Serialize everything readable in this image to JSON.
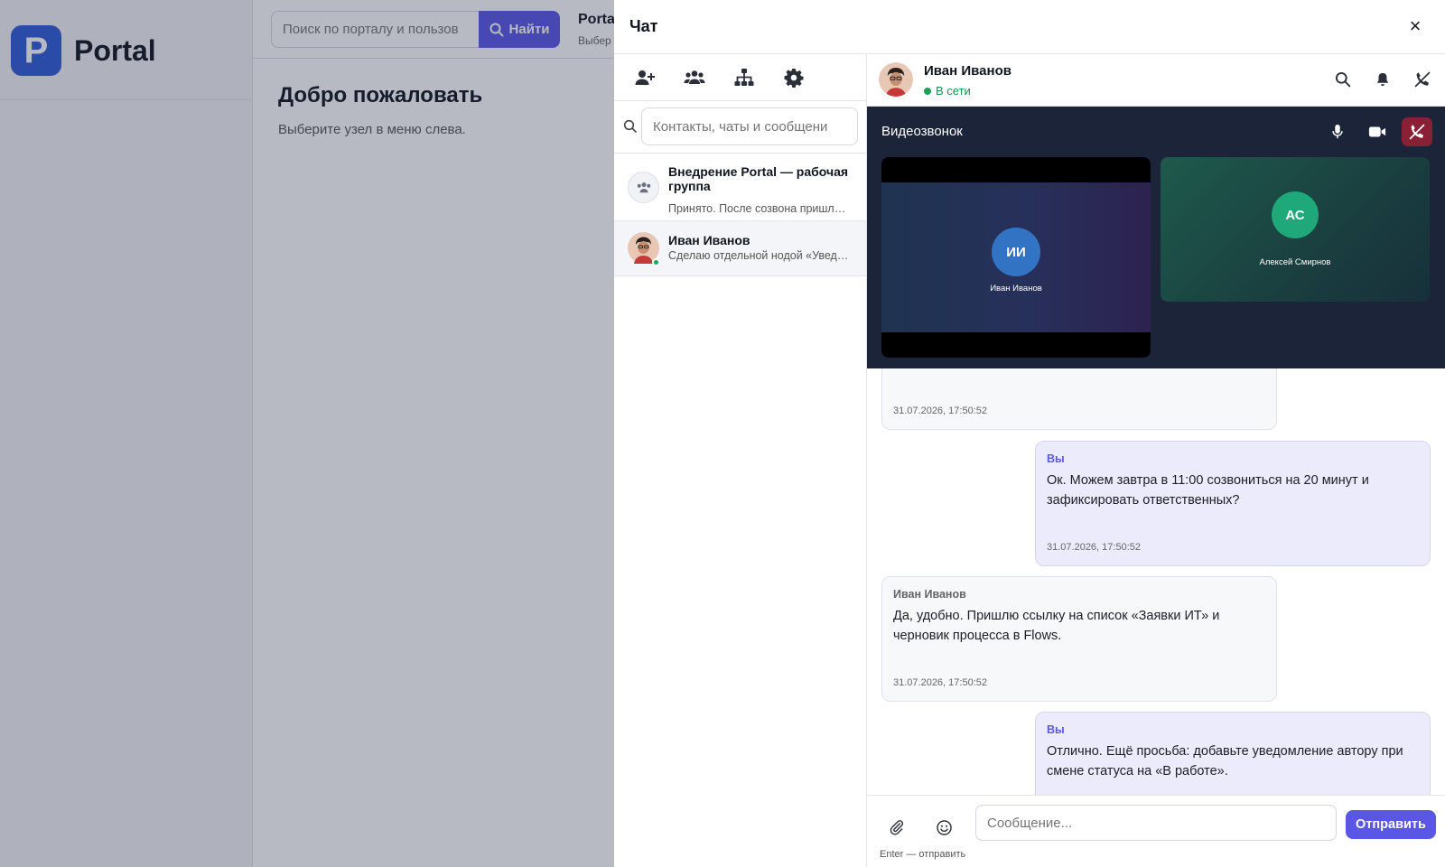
{
  "portal": {
    "brand_letter": "P",
    "brand_name": "Portal",
    "search_placeholder": "Поиск по порталу и пользов",
    "search_button": "Найти",
    "top_title": "Porta",
    "top_subtitle": "Выбер",
    "welcome_title": "Добро пожаловать",
    "welcome_subtitle": "Выберите узел в меню слева."
  },
  "chat": {
    "title": "Чат",
    "close_glyph": "×",
    "toolbar_icons": [
      "add-contact-icon",
      "group-icon",
      "org-structure-icon",
      "settings-icon"
    ],
    "contacts_search_placeholder": "Контакты, чаты и сообщени",
    "conversations": [
      {
        "title": "Внедрение Portal — рабочая группа",
        "last_message": "Принято. После созвона пришлю …"
      },
      {
        "title": "Иван Иванов",
        "last_message": "Сделаю отдельной нодой «Уведо…",
        "online": true
      }
    ],
    "peer": {
      "name": "Иван Иванов",
      "status": "В сети"
    },
    "video_call": {
      "title": "Видеозвонок",
      "participants": [
        {
          "initials": "ИИ",
          "name": "Иван Иванов",
          "color": "#3273c4"
        },
        {
          "initials": "АС",
          "name": "Алексей Смирнов",
          "color": "#1fa87a"
        }
      ]
    },
    "messages": [
      {
        "author": "",
        "text": "",
        "time": "31.07.2026, 17:50:52",
        "direction": "in"
      },
      {
        "author": "Вы",
        "text": "Ок. Можем завтра в 11:00 созвониться на 20 минут и зафиксировать ответственных?",
        "time": "31.07.2026, 17:50:52",
        "direction": "out"
      },
      {
        "author": "Иван Иванов",
        "text": "Да, удобно. Пришлю ссылку на список «Заявки ИТ» и черновик процесса в Flows.",
        "time": "31.07.2026, 17:50:52",
        "direction": "in"
      },
      {
        "author": "Вы",
        "text": "Отлично. Ещё просьба: добавьте уведомление автору при смене статуса на «В работе».",
        "time": "",
        "direction": "out"
      }
    ],
    "composer": {
      "placeholder": "Сообщение...",
      "send_label": "Отправить",
      "hint": "Enter — отправить"
    },
    "colors": {
      "accent": "#5a57e6",
      "online": "#1fa05a",
      "video_bg": "#1c2439",
      "hangup": "#8a2035"
    }
  }
}
